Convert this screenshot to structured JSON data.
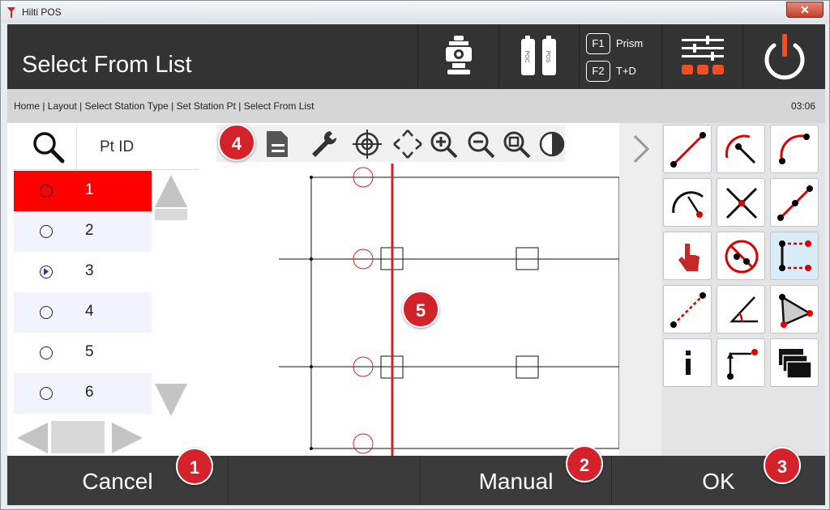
{
  "window": {
    "title": "Hilti POS",
    "close_glyph": "✕"
  },
  "header": {
    "page_title": "Select From List",
    "battery_labels": [
      "POC",
      "POS"
    ],
    "f1_key": "F1",
    "f1_label": "Prism",
    "f2_key": "F2",
    "f2_label": "T+D"
  },
  "breadcrumb": {
    "text": "Home | Layout | Select Station Type | Set Station Pt | Select From List",
    "time": "03:06"
  },
  "list": {
    "column_header": "Pt ID",
    "rows": [
      {
        "label": "1",
        "selected": true
      },
      {
        "label": "2",
        "selected": false
      },
      {
        "label": "3",
        "selected": false
      },
      {
        "label": "4",
        "selected": false
      },
      {
        "label": "5",
        "selected": false
      },
      {
        "label": "6",
        "selected": false
      }
    ]
  },
  "footer": {
    "cancel_label": "Cancel",
    "manual_label": "Manual",
    "ok_label": "OK"
  },
  "badges": [
    "1",
    "2",
    "3",
    "4",
    "5"
  ],
  "colors": {
    "accent_red": "#ff0000",
    "header_bg": "#333333",
    "badge_red": "#d3222a",
    "power_orange": "#f04e23"
  }
}
